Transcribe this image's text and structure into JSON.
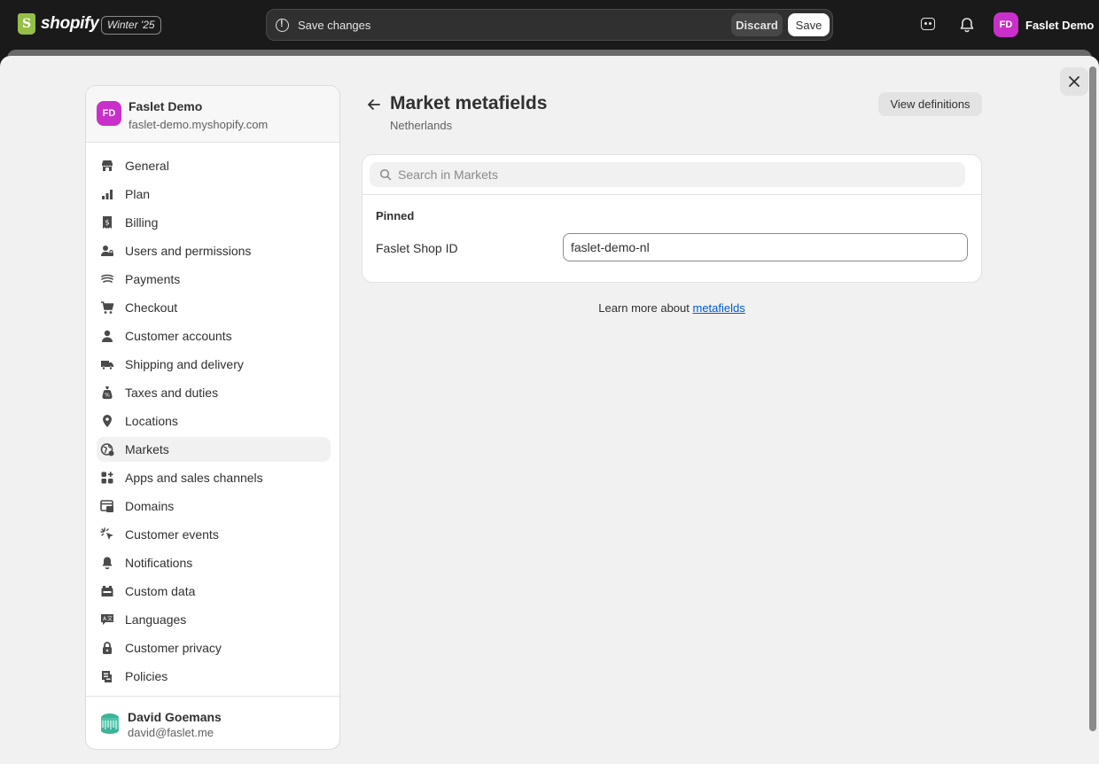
{
  "topbar": {
    "logo_text": "shopify",
    "edition": "Winter '25",
    "savebar_text": "Save changes",
    "discard_label": "Discard",
    "save_label": "Save",
    "user_initials": "FD",
    "user_name": "Faslet Demo"
  },
  "store": {
    "initials": "FD",
    "name": "Faslet Demo",
    "domain": "faslet-demo.myshopify.com"
  },
  "sidebar": {
    "items": [
      {
        "label": "General",
        "icon": "store-icon"
      },
      {
        "label": "Plan",
        "icon": "plan-icon"
      },
      {
        "label": "Billing",
        "icon": "receipt-icon"
      },
      {
        "label": "Users and permissions",
        "icon": "users-lock-icon"
      },
      {
        "label": "Payments",
        "icon": "payments-icon"
      },
      {
        "label": "Checkout",
        "icon": "cart-icon"
      },
      {
        "label": "Customer accounts",
        "icon": "person-icon"
      },
      {
        "label": "Shipping and delivery",
        "icon": "truck-icon"
      },
      {
        "label": "Taxes and duties",
        "icon": "tax-bag-icon"
      },
      {
        "label": "Locations",
        "icon": "location-pin-icon"
      },
      {
        "label": "Markets",
        "icon": "globe-icon",
        "active": true
      },
      {
        "label": "Apps and sales channels",
        "icon": "apps-icon"
      },
      {
        "label": "Domains",
        "icon": "domains-icon"
      },
      {
        "label": "Customer events",
        "icon": "cursor-click-icon"
      },
      {
        "label": "Notifications",
        "icon": "bell-icon"
      },
      {
        "label": "Custom data",
        "icon": "custom-data-icon"
      },
      {
        "label": "Languages",
        "icon": "language-icon"
      },
      {
        "label": "Customer privacy",
        "icon": "lock-icon"
      },
      {
        "label": "Policies",
        "icon": "policy-icon"
      }
    ]
  },
  "footer_user": {
    "name": "David Goemans",
    "email": "david@faslet.me"
  },
  "main": {
    "title": "Market metafields",
    "subtitle": "Netherlands",
    "view_definitions_label": "View definitions",
    "search_placeholder": "Search in Markets",
    "pinned_label": "Pinned",
    "field_label": "Faslet Shop ID",
    "field_value": "faslet-demo-nl",
    "learn_more_text": "Learn more about ",
    "learn_more_link": "metafields"
  },
  "colors": {
    "topbar_bg": "#1a1a1a",
    "avatar_bg": "#c930c9",
    "link": "#005bd3",
    "shopify_green": "#95bf47"
  }
}
